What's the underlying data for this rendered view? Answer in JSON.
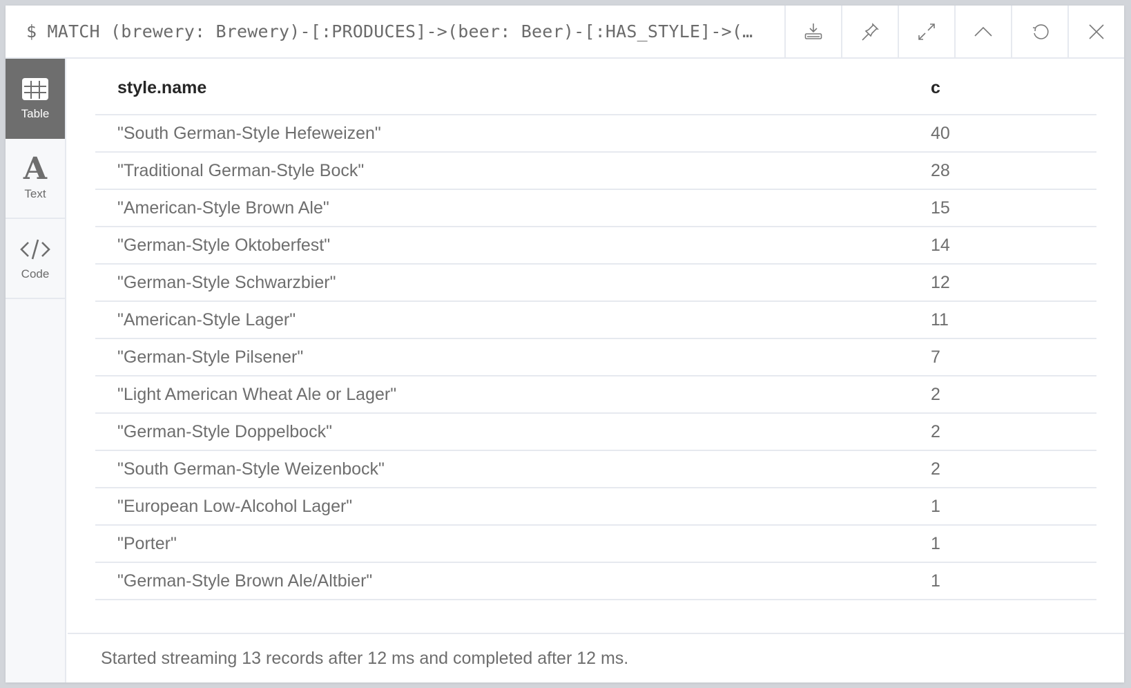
{
  "header": {
    "query": "$ MATCH (brewery: Brewery)-[:PRODUCES]->(beer: Beer)-[:HAS_STYLE]->(…",
    "buttons": [
      {
        "name": "download",
        "icon": "download-icon"
      },
      {
        "name": "pin",
        "icon": "pin-icon"
      },
      {
        "name": "fullscreen",
        "icon": "expand-icon"
      },
      {
        "name": "collapse",
        "icon": "chevron-up-icon"
      },
      {
        "name": "rerun",
        "icon": "refresh-icon"
      },
      {
        "name": "close",
        "icon": "close-icon"
      }
    ]
  },
  "sidebar": {
    "items": [
      {
        "label": "Table",
        "icon": "table-icon",
        "active": true
      },
      {
        "label": "Text",
        "icon": "text-icon",
        "active": false
      },
      {
        "label": "Code",
        "icon": "code-icon",
        "active": false
      }
    ]
  },
  "table": {
    "columns": [
      "style.name",
      "c"
    ],
    "rows": [
      [
        "\"South German-Style Hefeweizen\"",
        "40"
      ],
      [
        "\"Traditional German-Style Bock\"",
        "28"
      ],
      [
        "\"American-Style Brown Ale\"",
        "15"
      ],
      [
        "\"German-Style Oktoberfest\"",
        "14"
      ],
      [
        "\"German-Style Schwarzbier\"",
        "12"
      ],
      [
        "\"American-Style Lager\"",
        "11"
      ],
      [
        "\"German-Style Pilsener\"",
        "7"
      ],
      [
        "\"Light American Wheat Ale or Lager\"",
        "2"
      ],
      [
        "\"German-Style Doppelbock\"",
        "2"
      ],
      [
        "\"South German-Style Weizenbock\"",
        "2"
      ],
      [
        "\"European Low-Alcohol Lager\"",
        "1"
      ],
      [
        "\"Porter\"",
        "1"
      ],
      [
        "\"German-Style Brown Ale/Altbier\"",
        "1"
      ]
    ]
  },
  "footer": {
    "status": "Started streaming 13 records after 12 ms and completed after 12 ms."
  }
}
